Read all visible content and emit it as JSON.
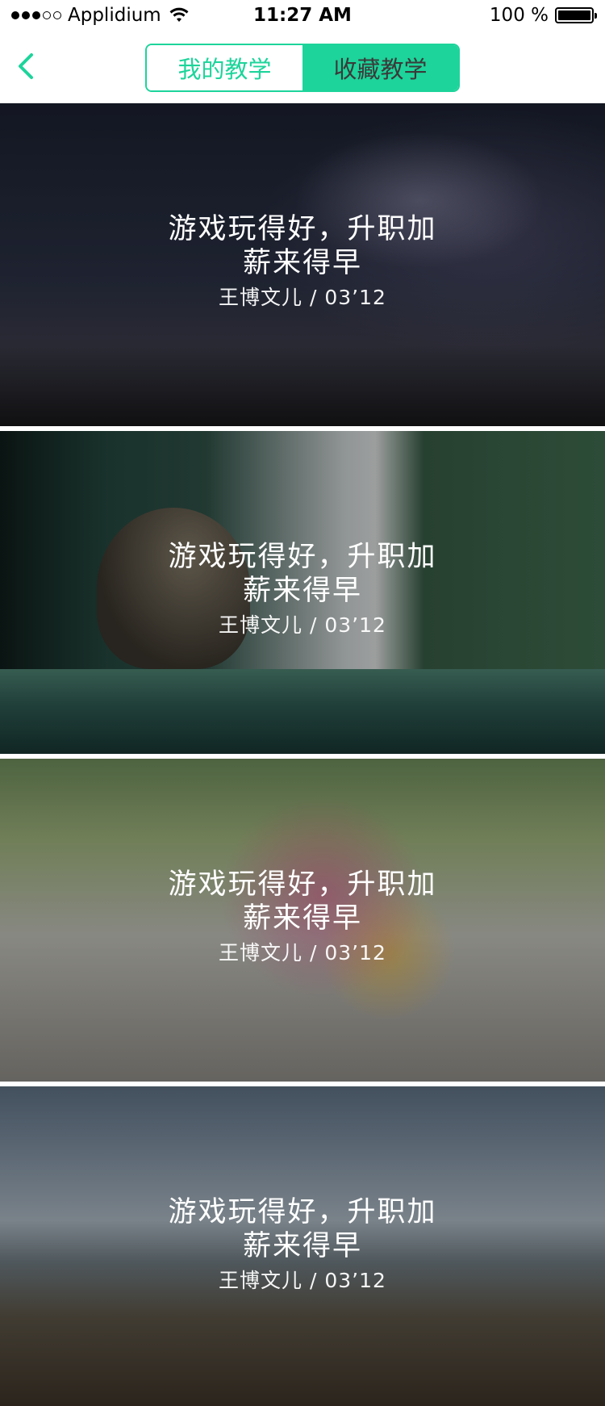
{
  "status_bar": {
    "carrier": "Applidium",
    "time": "11:27 AM",
    "battery": "100 %"
  },
  "nav": {
    "back_icon": "chevron-left-icon",
    "tabs": [
      {
        "label": "我的教学",
        "selected": false
      },
      {
        "label": "收藏教学",
        "selected": true
      }
    ],
    "accent_color": "#1dd49a"
  },
  "cards": [
    {
      "title": "游戏玩得好，升职加薪来得早",
      "meta": "王博文儿 / 03’12",
      "image": "starry night tree"
    },
    {
      "title": "游戏玩得好，升职加薪来得早",
      "meta": "王博文儿 / 03’12",
      "image": "cat on windowsill"
    },
    {
      "title": "游戏玩得好，升职加薪来得早",
      "meta": "王博文儿 / 03’12",
      "image": "flower cart street"
    },
    {
      "title": "游戏玩得好，升职加薪来得早",
      "meta": "王博文儿 / 03’12",
      "image": "mountain landscape"
    }
  ]
}
